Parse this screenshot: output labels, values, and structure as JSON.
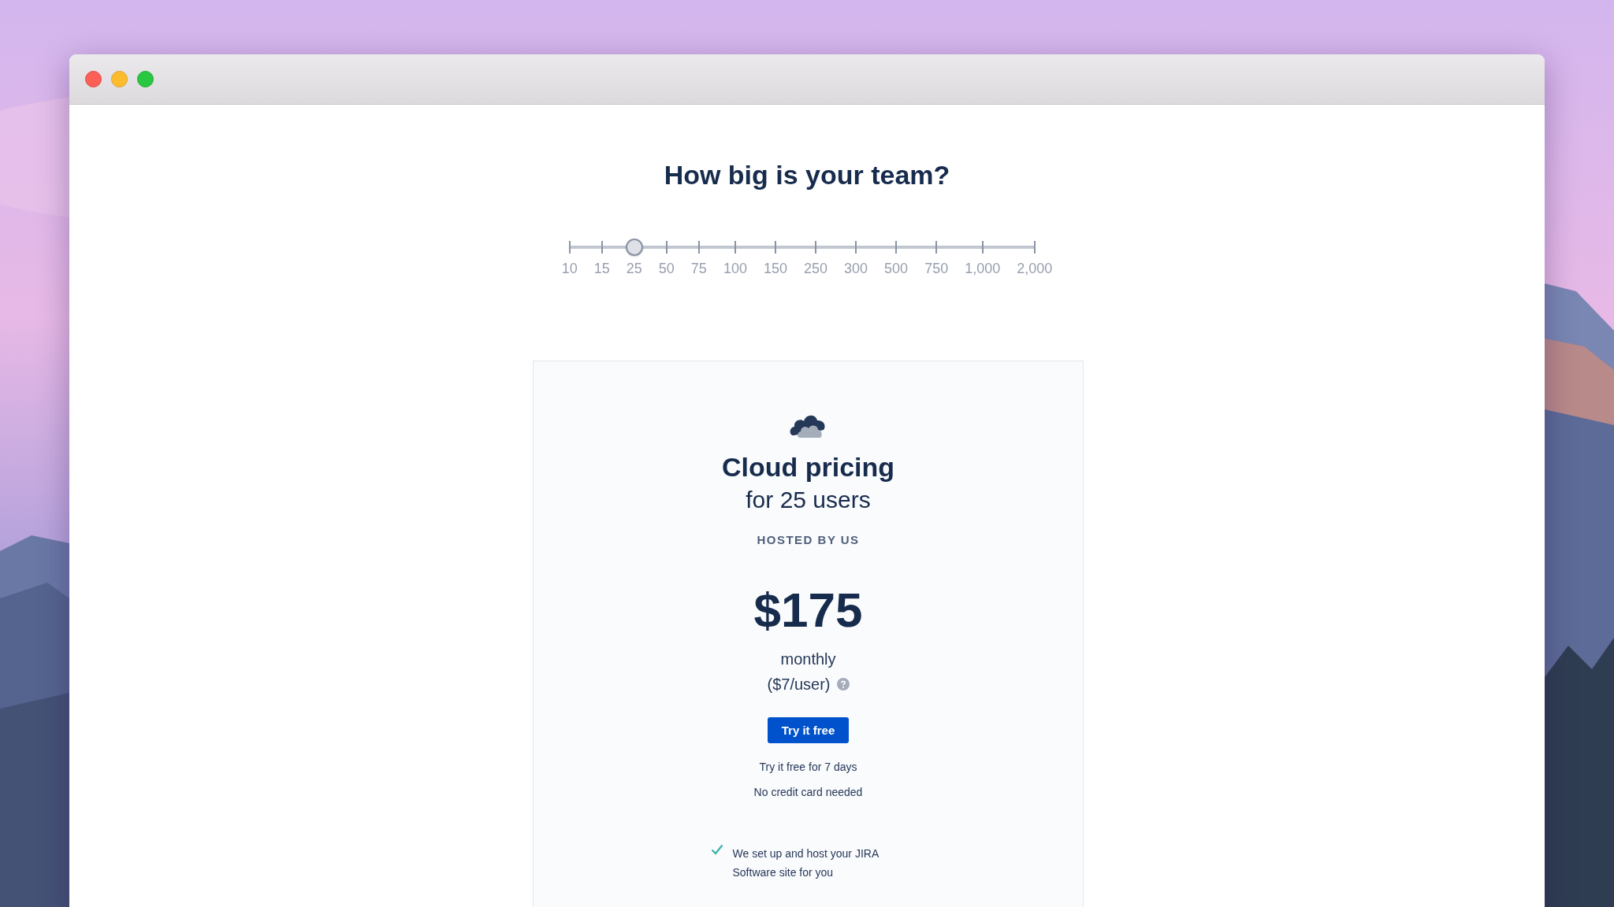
{
  "question": "How big is your team?",
  "slider": {
    "stops": [
      {
        "label": "10",
        "selected": false
      },
      {
        "label": "15",
        "selected": false
      },
      {
        "label": "25",
        "selected": true
      },
      {
        "label": "50",
        "selected": false
      },
      {
        "label": "75",
        "selected": false
      },
      {
        "label": "100",
        "selected": false
      },
      {
        "label": "150",
        "selected": false
      },
      {
        "label": "250",
        "selected": false
      },
      {
        "label": "300",
        "selected": false
      },
      {
        "label": "500",
        "selected": false
      },
      {
        "label": "750",
        "selected": false
      },
      {
        "label": "1,000",
        "selected": false
      },
      {
        "label": "2,000",
        "selected": false
      }
    ]
  },
  "card": {
    "title": "Cloud pricing",
    "subtitle": "for 25 users",
    "hosting": "HOSTED BY US",
    "price": "$175",
    "period": "monthly",
    "per_user": "($7/user)",
    "button": "Try it free",
    "notes": [
      "Try it free for 7 days",
      "No credit card needed"
    ],
    "features": [
      "We set up and host your JIRA Software site for you"
    ]
  }
}
